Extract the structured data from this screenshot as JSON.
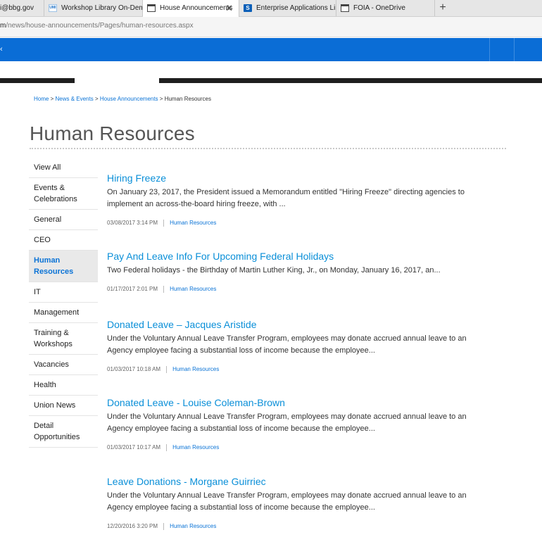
{
  "browser": {
    "tabs": [
      {
        "title": "i@bbg.gov",
        "icon": "page-icon",
        "active": false
      },
      {
        "title": "Workshop Library On-Dema",
        "icon": "workshop-icon",
        "active": false
      },
      {
        "title": "House Announcements",
        "icon": "page-icon",
        "active": true
      },
      {
        "title": "Enterprise Applications Limi",
        "icon": "sharepoint-icon",
        "active": false
      },
      {
        "title": "FOIA - OneDrive",
        "icon": "page-icon",
        "active": false
      }
    ],
    "close_glyph": "✕",
    "new_tab_glyph": "+",
    "url_prefix": "m",
    "url_path": "/news/house-announcements/Pages/human-resources.aspx",
    "workshop_fav_text": "UMI",
    "sharepoint_fav_text": "S"
  },
  "header": {
    "corner_glyph": "‹",
    "accent_color": "#0a6dd6"
  },
  "breadcrumb": {
    "home": "Home",
    "sep": " > ",
    "news": "News & Events",
    "announcements": "House Announcements",
    "current": "Human Resources"
  },
  "page": {
    "title": "Human Resources"
  },
  "nav": {
    "items": [
      {
        "label": "View All"
      },
      {
        "label": "Events & Celebrations"
      },
      {
        "label": "General"
      },
      {
        "label": "CEO"
      },
      {
        "label": "Human Resources",
        "active": true
      },
      {
        "label": "IT"
      },
      {
        "label": "Management"
      },
      {
        "label": "Training & Workshops"
      },
      {
        "label": "Vacancies"
      },
      {
        "label": "Health"
      },
      {
        "label": "Union News"
      },
      {
        "label": "Detail Opportunities"
      }
    ]
  },
  "articles": [
    {
      "title": "Hiring Freeze",
      "summary": "On January 23, 2017, the President issued a Memorandum entitled \"Hiring Freeze\" directing agencies to implement an across-the-board hiring freeze, with ...",
      "date": "03/08/2017 3:14 PM",
      "category": "Human Resources"
    },
    {
      "title": "Pay And Leave Info For Upcoming Federal Holidays",
      "summary": "Two Federal holidays - the Birthday of Martin Luther King, Jr., on Monday, January 16, 2017, an...",
      "date": "01/17/2017 2:01 PM",
      "category": "Human Resources"
    },
    {
      "title": "Donated Leave – Jacques Aristide",
      "summary": "Under the Voluntary Annual Leave Transfer Program, employees may donate accrued annual leave to an Agency employee facing a substantial loss of income because the employee...",
      "date": "01/03/2017 10:18 AM",
      "category": "Human Resources"
    },
    {
      "title": "Donated Leave - Louise Coleman-Brown",
      "summary": "Under the Voluntary Annual Leave Transfer Program, employees may donate accrued annual leave to an Agency employee facing a substantial loss of income because the employee...",
      "date": "01/03/2017 10:17 AM",
      "category": "Human Resources"
    },
    {
      "title": "Leave Donations - Morgane Guirriec",
      "summary": "Under the Voluntary Annual Leave Transfer Program, employees may donate accrued annual leave to an Agency employee facing a substantial loss of income because the employee...",
      "date": "12/20/2016 3:20 PM",
      "category": "Human Resources"
    }
  ]
}
